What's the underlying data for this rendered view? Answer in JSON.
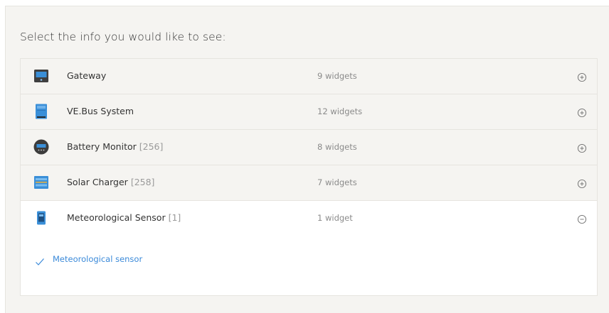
{
  "heading": "Select the info you would like to see:",
  "colors": {
    "accent": "#3b8ad9",
    "device_blue": "#3a8fd8",
    "panel_bg": "#f5f4f1"
  },
  "devices": [
    {
      "name": "Gateway",
      "instance": "",
      "widgets": "9 widgets",
      "icon": "gateway-device-icon",
      "toggle": "plus"
    },
    {
      "name": "VE.Bus System",
      "instance": "",
      "widgets": "12 widgets",
      "icon": "inverter-device-icon",
      "toggle": "plus"
    },
    {
      "name": "Battery Monitor",
      "instance": "[256]",
      "widgets": "8 widgets",
      "icon": "battery-monitor-icon",
      "toggle": "plus"
    },
    {
      "name": "Solar Charger",
      "instance": "[258]",
      "widgets": "7 widgets",
      "icon": "solar-charger-icon",
      "toggle": "plus"
    },
    {
      "name": "Meteorological Sensor",
      "instance": "[1]",
      "widgets": "1 widget",
      "icon": "meteo-sensor-icon",
      "toggle": "minus"
    }
  ],
  "expanded": {
    "items": [
      {
        "label": "Meteorological sensor",
        "checked": true,
        "icon": "checkmark-icon"
      }
    ]
  }
}
